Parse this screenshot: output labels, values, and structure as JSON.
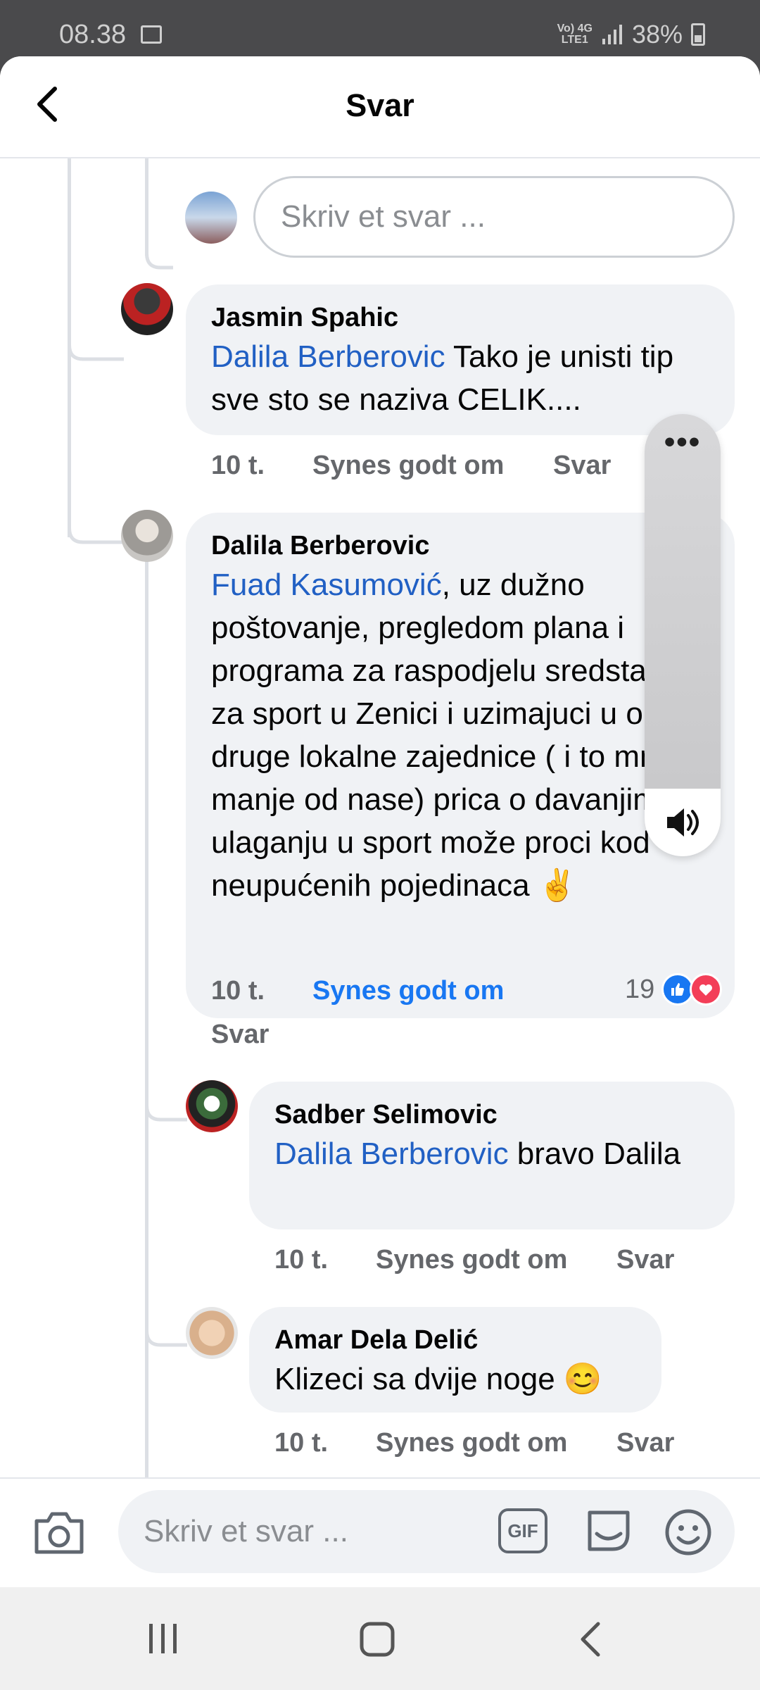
{
  "status_bar": {
    "time": "08.38",
    "network_top": "Vo) 4G",
    "network_bottom": "LTE1",
    "battery": "38%"
  },
  "header": {
    "title": "Svar"
  },
  "reply_box_placeholder": "Skriv et svar ...",
  "comments": [
    {
      "author": "Jasmin Spahic",
      "mention": "Dalila Berberovic",
      "text": " Tako je unisti tip sve sto se naziva CELIK....",
      "time": "10 t.",
      "like": "Synes godt om",
      "reply": "Svar"
    },
    {
      "author": "Dalila Berberovic",
      "mention": "Fuad Kasumović",
      "text": ", uz dužno poštovanje, pregledom plana i programa za raspodjelu sredstava za sport u Zenici i uzimajuci u obzir druge lokalne zajednice ( i to mnogo manje od nase) prica o davanjima i ulaganju u sport može proci kod neupućenih pojedinaca ✌️",
      "time": "10 t.",
      "like": "Synes godt om",
      "reply": "Svar",
      "reaction_count": "19"
    },
    {
      "author": "Sadber Selimovic",
      "mention": "Dalila Berberovic",
      "text": " bravo Dalila",
      "time": "10 t.",
      "like": "Synes godt om",
      "reply": "Svar"
    },
    {
      "author": "Amar Dela Delić",
      "mention": "",
      "text": "Klizeci sa dvije noge 😊",
      "time": "10 t.",
      "like": "Synes godt om",
      "reply": "Svar"
    }
  ],
  "composer": {
    "placeholder": "Skriv et svar ...",
    "gif_label": "GIF"
  },
  "colors": {
    "mention": "#2160c4",
    "like_active": "#1877f2",
    "bubble": "#f0f2f5"
  }
}
